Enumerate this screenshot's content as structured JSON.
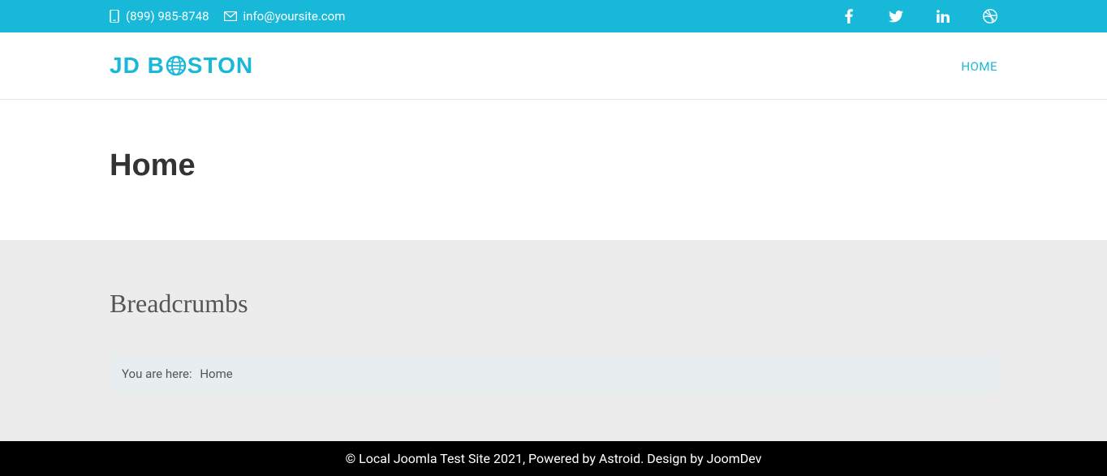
{
  "topbar": {
    "phone": "(899) 985-8748",
    "email": "info@yoursite.com"
  },
  "header": {
    "logo_part1": "JD B",
    "logo_part2": "STON",
    "nav_home": "HOME"
  },
  "main": {
    "page_title": "Home"
  },
  "breadcrumbs": {
    "section_title": "Breadcrumbs",
    "label": "You are here:",
    "current": "Home"
  },
  "footer": {
    "text_prefix": "© Local Joomla Test Site 2021, Powered by ",
    "link1": "Astroid",
    "text_mid": ". Design by ",
    "link2": "JoomDev"
  }
}
